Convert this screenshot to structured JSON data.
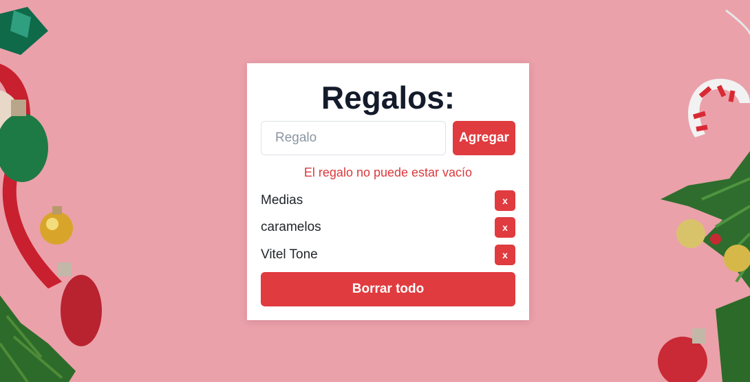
{
  "header": {
    "title": "Regalos:"
  },
  "form": {
    "input_value": "",
    "input_placeholder": "Regalo",
    "add_label": "Agregar",
    "error_message": "El regalo no puede estar vacío"
  },
  "gifts": [
    {
      "name": "Medias",
      "delete_label": "x"
    },
    {
      "name": "caramelos",
      "delete_label": "x"
    },
    {
      "name": "Vitel Tone",
      "delete_label": "x"
    }
  ],
  "clear_all_label": "Borrar todo",
  "colors": {
    "accent": "#e03b3f",
    "background": "#eaa1aa",
    "title": "#141b2b"
  },
  "decorations": [
    "christmas-ornaments",
    "candy-cane",
    "pine-branch",
    "red-ribbon"
  ]
}
